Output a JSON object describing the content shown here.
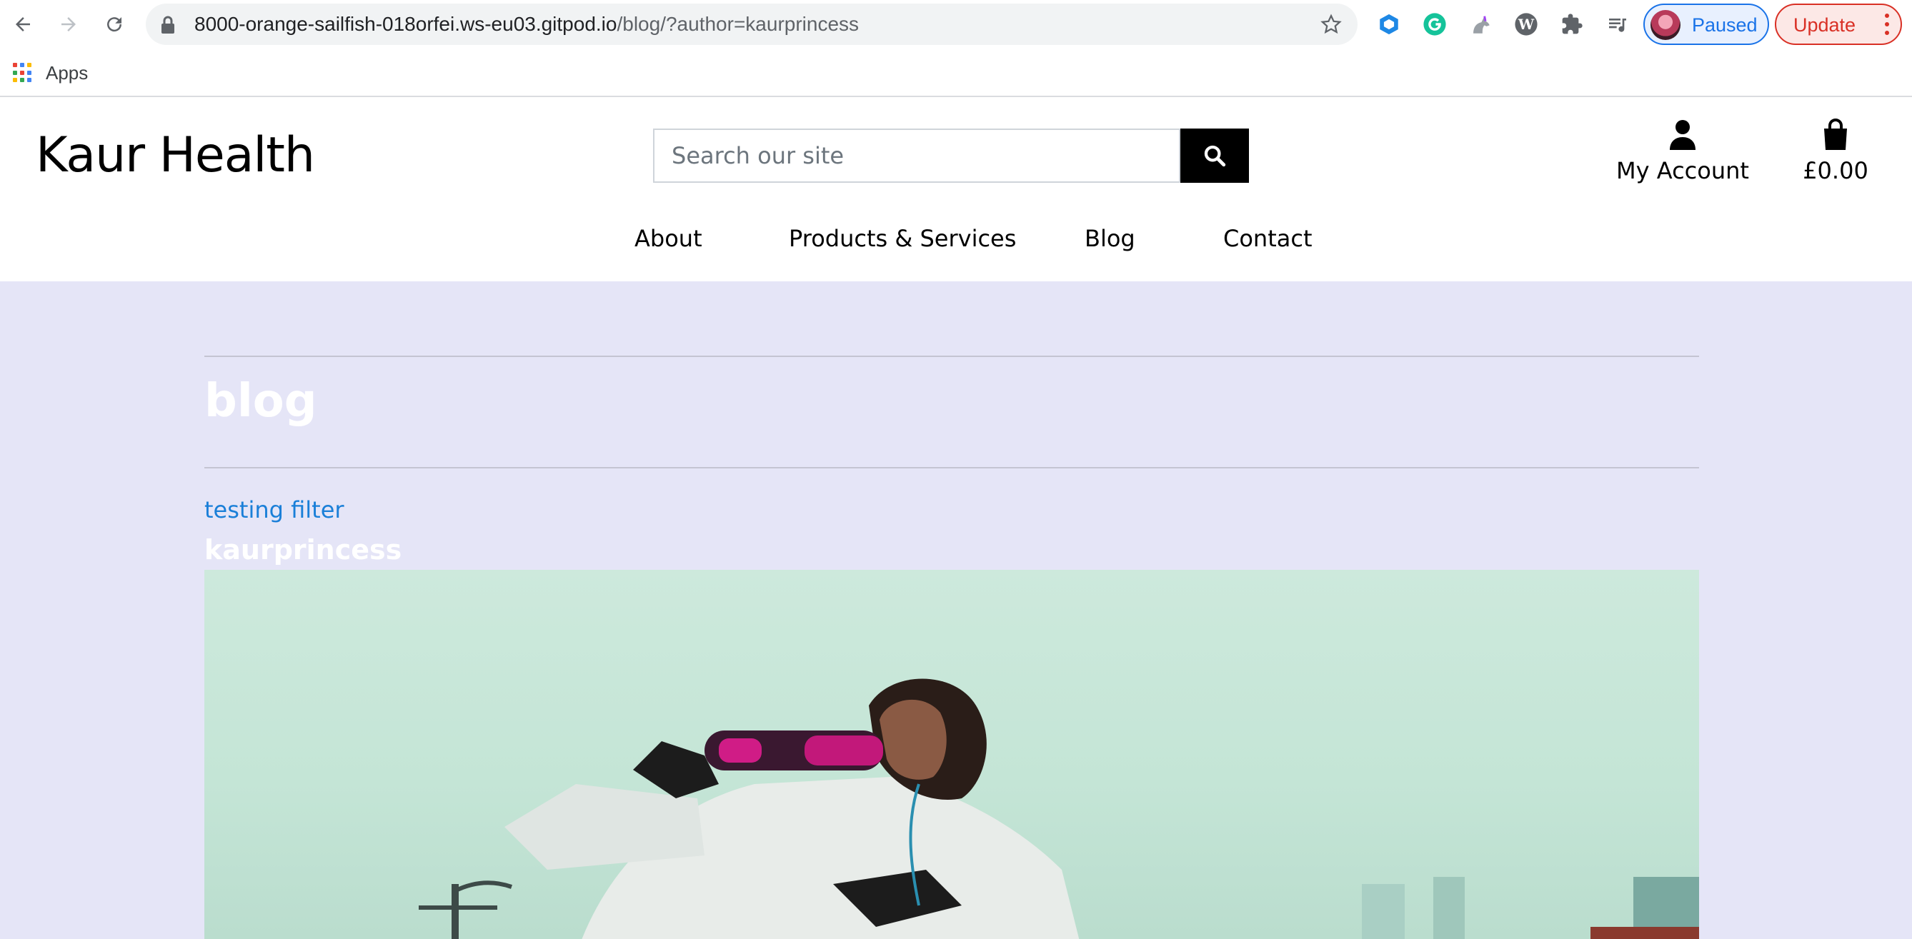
{
  "browser": {
    "url_host": "8000-orange-sailfish-018orfei.ws-eu03.gitpod.io",
    "url_path": "/blog/?author=kaurprincess",
    "profile_label": "Paused",
    "update_label": "Update",
    "bookmarks": [
      {
        "label": "Apps"
      }
    ],
    "extension_icons": [
      "cube-extension-icon",
      "grammarly-icon",
      "unicorn-extension-icon",
      "wordpress-icon",
      "puzzle-extensions-icon",
      "reading-list-icon"
    ]
  },
  "site": {
    "logo": "Kaur Health",
    "search_placeholder": "Search our site",
    "account_label": "My Account",
    "bag_total": "£0.00",
    "nav": [
      {
        "label": "About"
      },
      {
        "label": "Products & Services"
      },
      {
        "label": "Blog"
      },
      {
        "label": "Contact"
      }
    ]
  },
  "page": {
    "title": "blog",
    "post": {
      "title": "testing filter",
      "author": "kaurprincess"
    }
  },
  "colors": {
    "page_background": "#e5e5f7",
    "link": "#1a7fd8",
    "search_button": "#000000"
  }
}
